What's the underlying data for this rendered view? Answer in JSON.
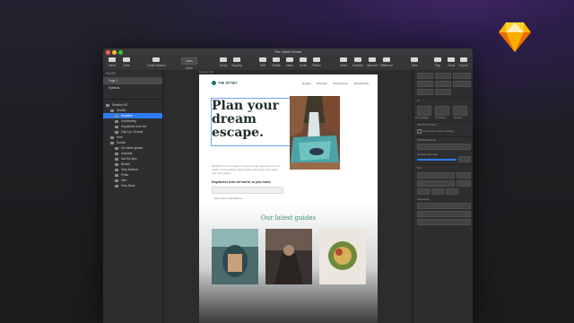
{
  "window": {
    "title": "The Jetset Home"
  },
  "toolbar": {
    "insert": "Insert",
    "data": "Data",
    "create_symbol": "Create Symbol",
    "zoom": "Zoom",
    "zoom_value": "100%",
    "group": "Group",
    "ungroup": "Ungroup",
    "edit": "Edit",
    "rotate": "Rotate",
    "mask": "Mask",
    "scale": "Scale",
    "flatten": "Flatten",
    "union": "Union",
    "subtract": "Subtract",
    "intersect": "Intersect",
    "difference": "Difference",
    "view": "View",
    "play": "Play",
    "cloud": "Cloud",
    "export": "Export"
  },
  "layers": {
    "pages_label": "PAGES",
    "pages": [
      "Page 1",
      "Symbols"
    ],
    "items": [
      {
        "label": "Desktop HD",
        "indent": 0
      },
      {
        "label": "Header",
        "indent": 1
      },
      {
        "label": "Headline",
        "indent": 2,
        "selected": true
      },
      {
        "label": "Subheading",
        "indent": 2
      },
      {
        "label": "Dispatches from the",
        "indent": 2
      },
      {
        "label": "Sign Up / Normal",
        "indent": 2
      },
      {
        "label": "Hero",
        "indent": 1
      },
      {
        "label": "Guides",
        "indent": 1
      },
      {
        "label": "Our latest guides",
        "indent": 2
      },
      {
        "label": "Australia",
        "indent": 2
      },
      {
        "label": "Into the Alps",
        "indent": 2
      },
      {
        "label": "Bhutan",
        "indent": 2
      },
      {
        "label": "Grey Balance",
        "indent": 2
      },
      {
        "label": "Photo",
        "indent": 2
      },
      {
        "label": "Intro",
        "indent": 2
      },
      {
        "label": "Gray Block",
        "indent": 2
      }
    ]
  },
  "artboard": {
    "label": "Desktop HD",
    "brand": "THE JETSET",
    "nav": [
      "Guides",
      "Retreats",
      "Experiences",
      "Restaurants"
    ],
    "headline": "Plan your dream escape.",
    "subheading": "Whether it’s a fun break or an epic journey, adventure is in the details. Let beautifully crafted guides and insider tips inspire your next escape.",
    "dispatch": "Dispatches from the world, to your inbox",
    "email_placeholder": "Enter your email address",
    "guides_title": "Our latest guides"
  },
  "inspector": {
    "appearance": "APPEARANCE",
    "prototyping": "PROTOTYPING",
    "fix_position": "Fix position when scrolling",
    "opacity_label": "Opacity (Normal)",
    "opacity_value": "100%",
    "text_label": "Text",
    "resize_labels": [
      "Fit to Edge",
      "Fit Mode",
      "Resize"
    ],
    "alignment": "Alignment"
  },
  "colors": {
    "accent": "#2f7cf6",
    "brand_teal": "#1a7566",
    "headline": "#1f2d2b"
  }
}
